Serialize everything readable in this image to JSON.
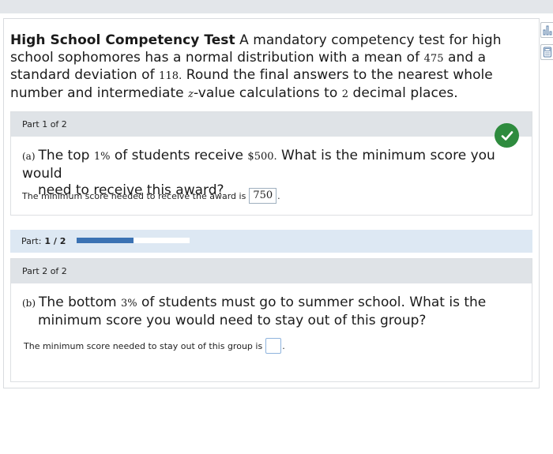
{
  "problem": {
    "title": "High School Competency Test",
    "text_before_mean": " A mandatory competency test for high school sophomores has a normal distribution with a mean of ",
    "mean": "475",
    "text_before_sd": " and a standard deviation of ",
    "sd": "118.",
    "text_before_z": " Round the final answers to the nearest whole number and intermediate ",
    "z_var": "z",
    "text_before_decimals": "-value calculations to ",
    "decimals": "2",
    "text_end": " decimal places."
  },
  "part1": {
    "header": "Part 1 of 2",
    "label": "(a)",
    "q_before_pct": "The top ",
    "pct": "1%",
    "q_mid": " of students receive ",
    "amount": "$500.",
    "q_line1_end": " What is the minimum score you would",
    "q_line2": "need to receive this award?",
    "answer_prompt": "The minimum score needed to receive the award is",
    "answer_value": "750",
    "answer_end": ".",
    "status": "correct",
    "status_color": "#2e8b3e"
  },
  "progress": {
    "label": "Part:",
    "fraction": "1 / 2",
    "value": 0.5,
    "fill_color": "#3b72b3"
  },
  "part2": {
    "header": "Part 2 of 2",
    "label": "(b)",
    "q_before_pct": "The bottom ",
    "pct": "3%",
    "q_line1_end": " of students must go to summer school. What is the",
    "q_line2": "minimum score you would need to stay out of this group?",
    "answer_prompt": "The minimum score needed to stay out of this group is",
    "answer_value": "",
    "answer_end": "."
  },
  "side_tools": [
    {
      "icon": "bar-chart-icon"
    },
    {
      "icon": "calculator-icon"
    }
  ]
}
